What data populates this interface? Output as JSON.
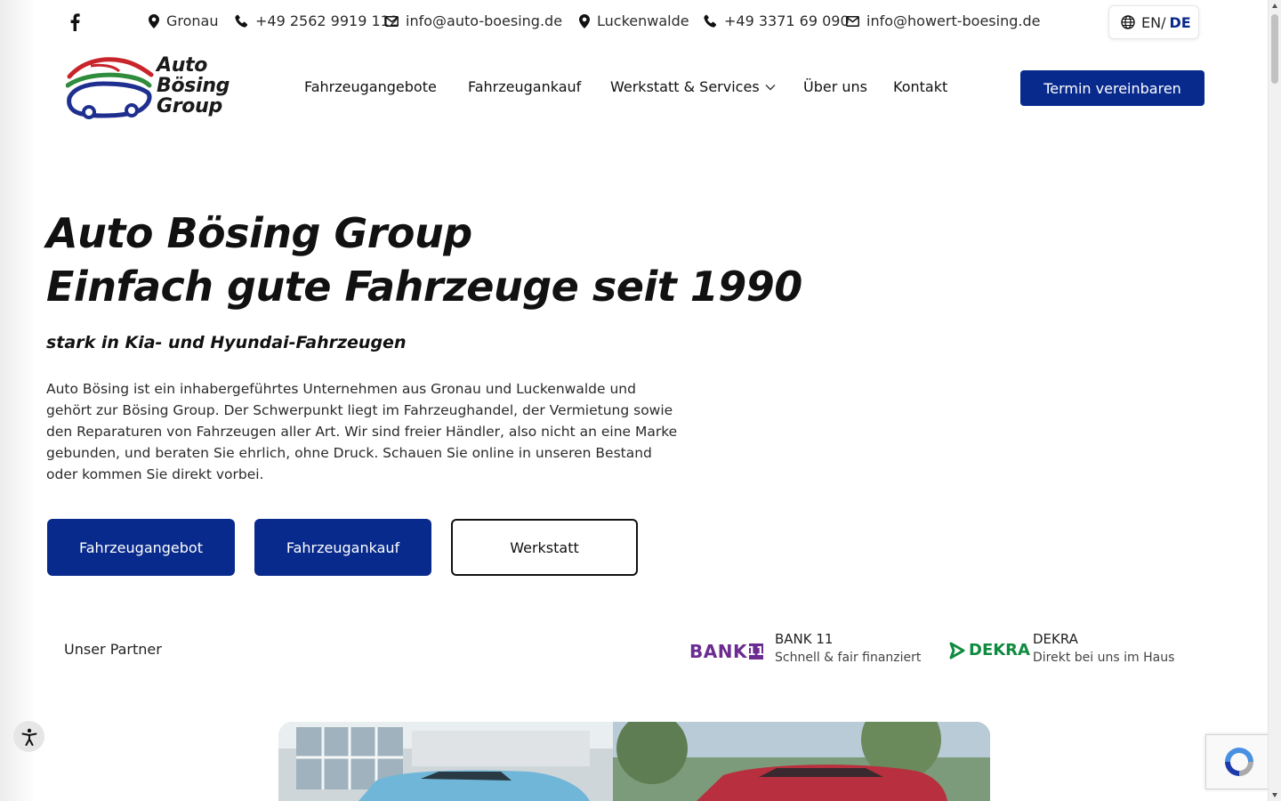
{
  "topbar": {
    "contacts": [
      {
        "type": "location",
        "text": "Gronau"
      },
      {
        "type": "phone",
        "text": "+49 2562 9919 112"
      },
      {
        "type": "email",
        "text": "info@auto-boesing.de"
      },
      {
        "type": "location",
        "text": "Luckenwalde"
      },
      {
        "type": "phone",
        "text": "+49 3371 69 090"
      },
      {
        "type": "email",
        "text": "info@howert-boesing.de"
      }
    ],
    "language": {
      "en": "EN/",
      "de": "DE"
    }
  },
  "header": {
    "logo": {
      "line1": "Auto",
      "line2": "Bösing",
      "line3": "Group"
    },
    "nav": [
      {
        "label": "Fahrzeugangebote"
      },
      {
        "label": "Fahrzeugankauf"
      },
      {
        "label": "Werkstatt & Services",
        "has_dropdown": true
      },
      {
        "label": "Über uns"
      },
      {
        "label": "Kontakt"
      }
    ],
    "cta_label": "Termin vereinbaren"
  },
  "hero": {
    "title_line1": "Auto Bösing Group",
    "title_line2": "Einfach gute Fahrzeuge seit 1990",
    "subtitle": "stark in Kia- und Hyundai-Fahrzeugen",
    "intro_lines": [
      "Auto Bösing ist ein inhabergeführtes Unternehmen aus Gronau und Luckenwalde und",
      "gehört zur Bösing Group. Der Schwerpunkt liegt im Fahrzeughandel, der Vermietung sowie",
      "den Reparaturen von Fahrzeugen aller Art. Wir sind freier Händler, also nicht an eine Marke",
      "gebunden, und beraten Sie ehrlich, ohne Druck. Schauen Sie online in unseren Bestand",
      "oder kommen Sie direkt vorbei."
    ],
    "buttons": [
      {
        "label": "Fahrzeugangebot",
        "style": "primary"
      },
      {
        "label": "Fahrzeugankauf",
        "style": "primary"
      },
      {
        "label": "Werkstatt",
        "style": "outline"
      }
    ]
  },
  "partners": {
    "label": "Unser Partner",
    "items": [
      {
        "logo_text": "BANK",
        "logo_badge": "11",
        "name": "BANK 11",
        "description": "Schnell & fair finanziert"
      },
      {
        "logo_text": "DEKRA",
        "name": "DEKRA",
        "description": "Direkt bei uns im Haus"
      }
    ]
  },
  "colors": {
    "primary": "#082a8c",
    "bank11": "#6b2c91",
    "dekra": "#0f8b3f"
  }
}
